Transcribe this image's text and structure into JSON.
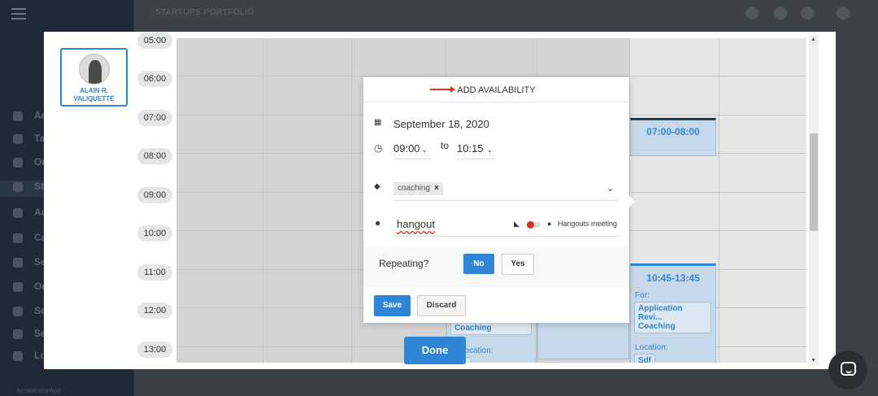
{
  "background": {
    "breadcrumb": "STARTUPS PORTFOLIO",
    "sidebar_items": [
      "Ac",
      "Ta",
      "Or",
      "St",
      "Ad",
      "Ca",
      "Se",
      "Or",
      "Se",
      "Se",
      "Lo"
    ],
    "footer_text": "AcceleratorApp"
  },
  "profile": {
    "name_line1": "ALAIN R.",
    "name_line2": "VALIQUETTE"
  },
  "times": [
    "05:00",
    "06:00",
    "07:00",
    "08:00",
    "09:00",
    "10:00",
    "11:00",
    "12:00",
    "13:00"
  ],
  "calendar": {
    "block1": {
      "time": "07:00-08:00"
    },
    "block2": {
      "time": "10:45-13:45",
      "for_label": "For:",
      "for_value_line1": "Application Revi...",
      "for_value_line2": "Coaching",
      "location_label": "Location:",
      "location_value": "Sdf"
    },
    "block3": {
      "for_value": "Coaching",
      "location_label": "Location:"
    },
    "done_label": "Done"
  },
  "popup": {
    "title": "ADD AVAILABILITY",
    "date": "September 18, 2020",
    "time_from": "09:00",
    "to_label": "to",
    "time_to": "10:15",
    "tag": "coaching",
    "location": "hangout",
    "hangouts_label": "Hangouts meeting",
    "repeating_label": "Repeating?",
    "no_label": "No",
    "yes_label": "Yes",
    "save_label": "Save",
    "discard_label": "Discard"
  },
  "colors": {
    "accent": "#2f86d6",
    "danger": "#e0301e"
  }
}
